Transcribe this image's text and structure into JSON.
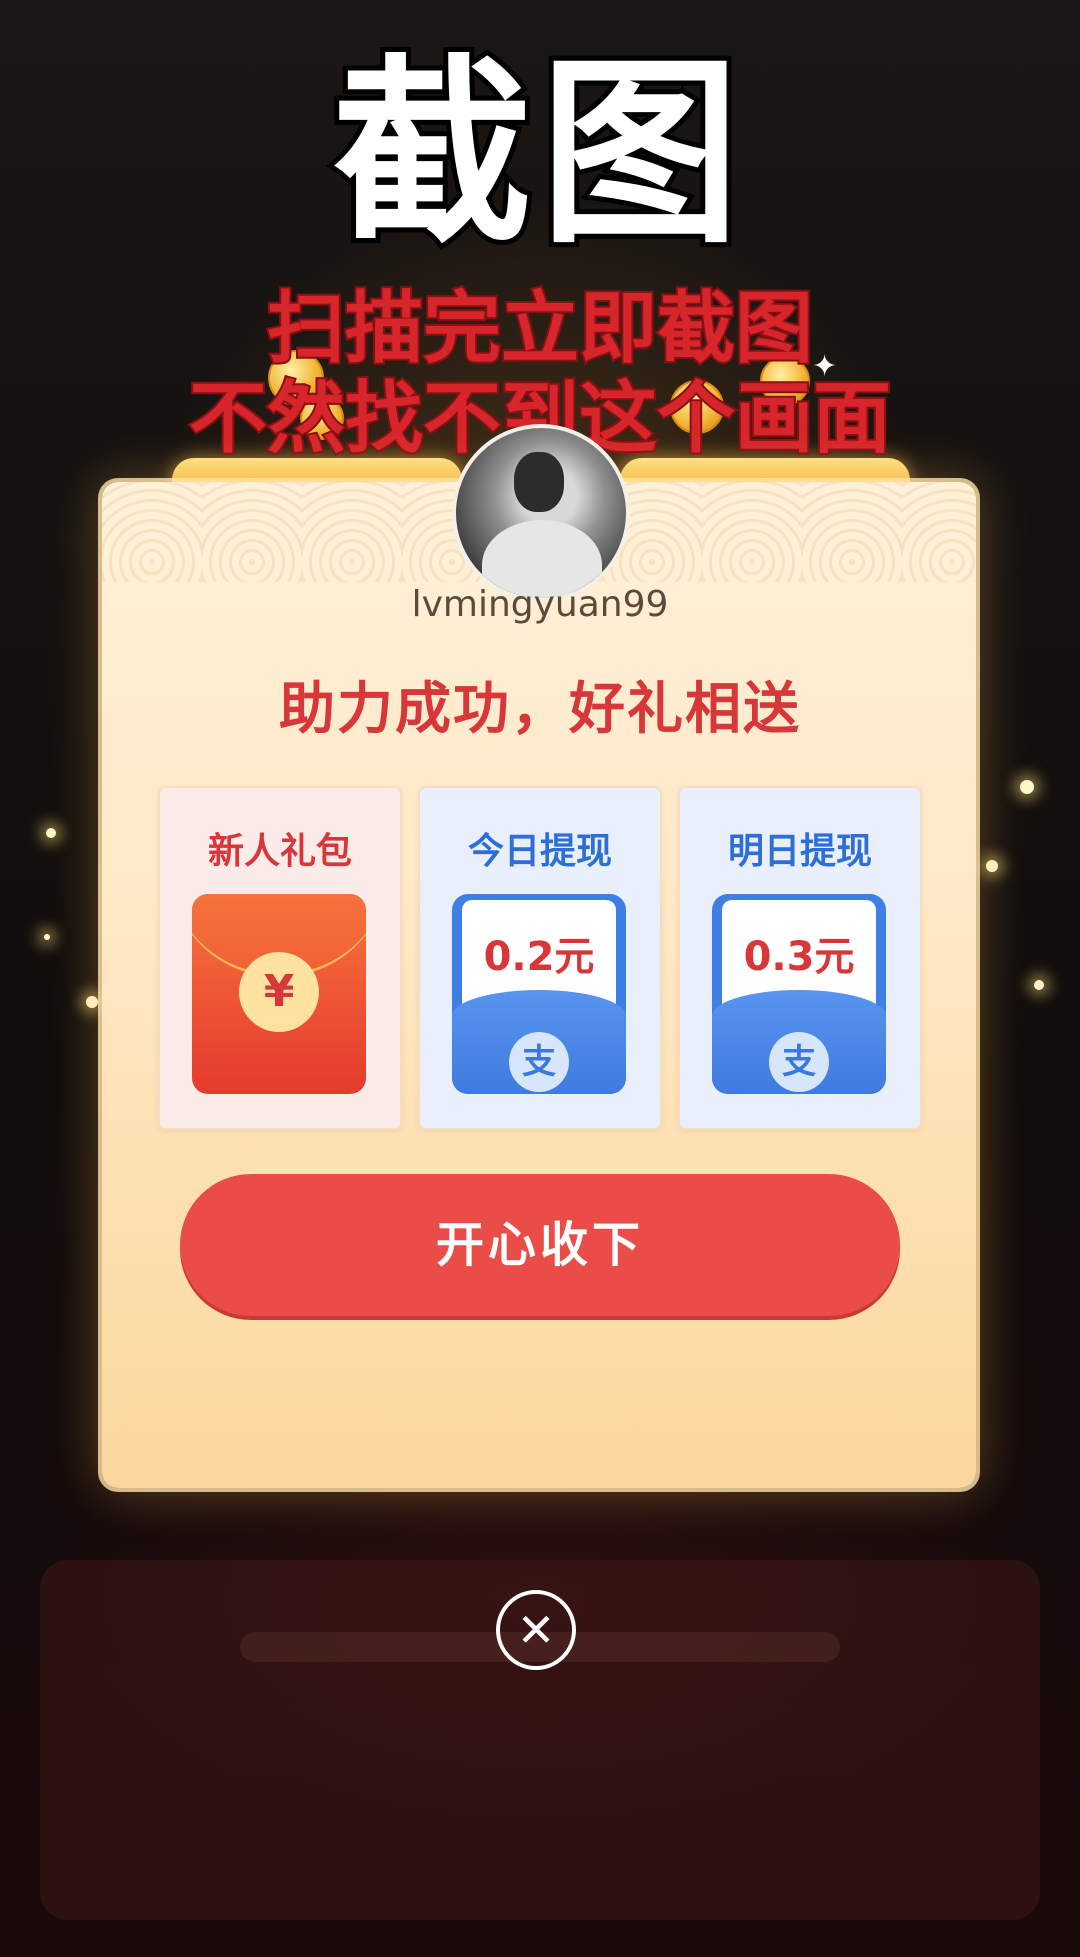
{
  "overlay": {
    "big_text": "截图",
    "line1": "扫描完立即截图",
    "line2": "不然找不到这个画面"
  },
  "modal": {
    "username": "lvmingyuan99",
    "headline": "助力成功，好礼相送",
    "cards": [
      {
        "title": "新人礼包",
        "icon": "red-envelope-icon",
        "seal": "¥"
      },
      {
        "title": "今日提现",
        "amount": "0.2元",
        "icon": "alipay-icon",
        "pay_symbol": "支"
      },
      {
        "title": "明日提现",
        "amount": "0.3元",
        "icon": "alipay-icon",
        "pay_symbol": "支"
      }
    ],
    "accept_label": "开心收下",
    "close_icon": "close-icon"
  },
  "colors": {
    "accent_red": "#ea4d47",
    "alipay_blue": "#3e7fe6",
    "modal_bg": "#ffeacb"
  }
}
